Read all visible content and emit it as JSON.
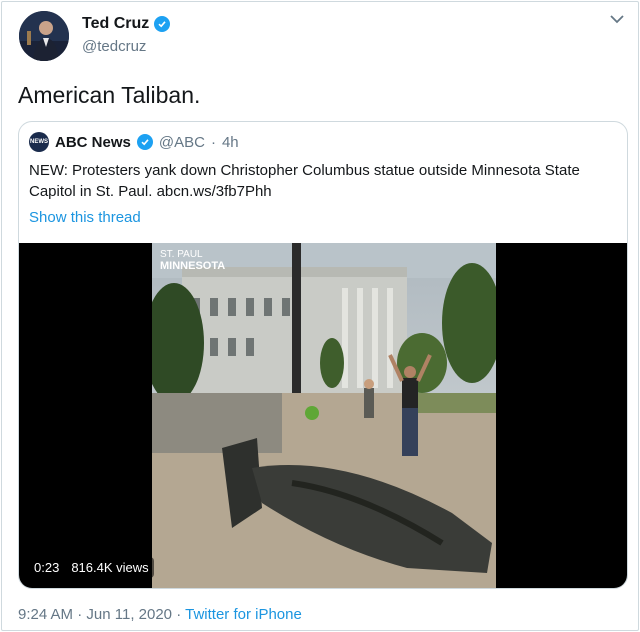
{
  "author": {
    "name": "Ted Cruz",
    "handle": "@tedcruz"
  },
  "tweet": {
    "text": "American Taliban."
  },
  "quoted_tweet": {
    "name": "ABC News",
    "handle": "@ABC",
    "separator": "·",
    "time": "4h",
    "logo_text": "NEWS",
    "text": "NEW: Protesters yank down Christopher Columbus statue outside Minnesota State Capitol in St. Paul. abcn.ws/3fb7Phh",
    "thread_link": "Show this thread",
    "video": {
      "overlay_line1": "ST. PAUL",
      "overlay_line2": "MINNESOTA",
      "duration": "0:23",
      "views": "816.4K views"
    }
  },
  "footer": {
    "time": "9:24 AM",
    "separator1": "·",
    "date": "Jun 11, 2020",
    "separator2": "·",
    "source": "Twitter for iPhone"
  },
  "colors": {
    "link": "#1b95e0",
    "verified": "#1da1f2",
    "muted": "#657786"
  }
}
